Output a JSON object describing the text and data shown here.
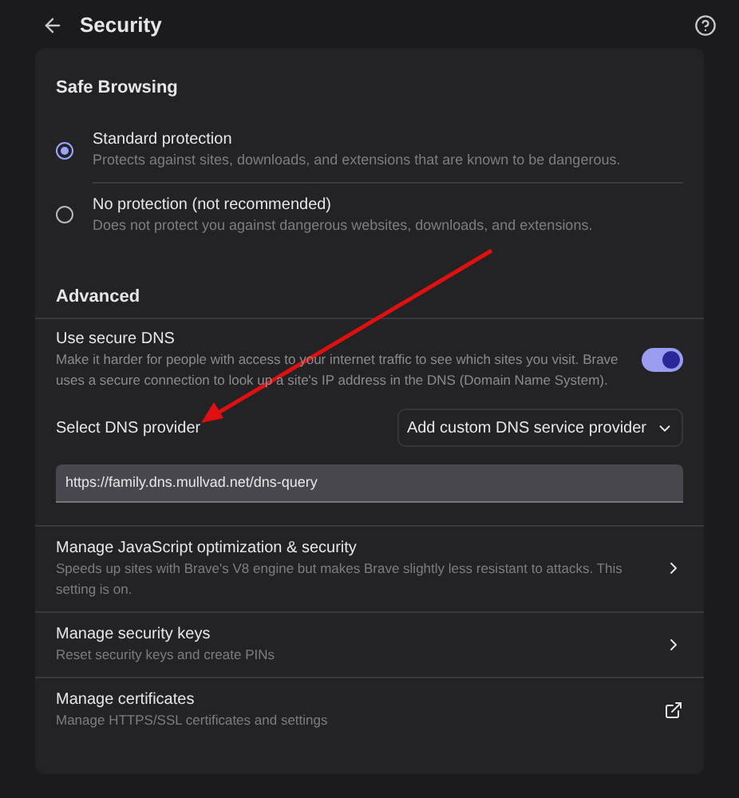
{
  "header": {
    "title": "Security"
  },
  "safe_browsing": {
    "heading": "Safe Browsing",
    "options": [
      {
        "title": "Standard protection",
        "description": "Protects against sites, downloads, and extensions that are known to be dangerous.",
        "selected": true
      },
      {
        "title": "No protection (not recommended)",
        "description": "Does not protect you against dangerous websites, downloads, and extensions.",
        "selected": false
      }
    ]
  },
  "advanced": {
    "heading": "Advanced",
    "secure_dns": {
      "title": "Use secure DNS",
      "description": "Make it harder for people with access to your internet traffic to see which sites you visit. Brave uses a secure connection to look up a site's IP address in the DNS (Domain Name System).",
      "on": true
    },
    "dns_provider": {
      "label": "Select DNS provider",
      "dropdown": "Add custom DNS service provider",
      "value": "https://family.dns.mullvad.net/dns-query"
    },
    "links": [
      {
        "title": "Manage JavaScript optimization & security",
        "description": "Speeds up sites with Brave's V8 engine but makes Brave slightly less resistant to attacks. This setting is on.",
        "kind": "subpage"
      },
      {
        "title": "Manage security keys",
        "description": "Reset security keys and create PINs",
        "kind": "subpage"
      },
      {
        "title": "Manage certificates",
        "description": "Manage HTTPS/SSL certificates and settings",
        "kind": "external"
      }
    ]
  }
}
